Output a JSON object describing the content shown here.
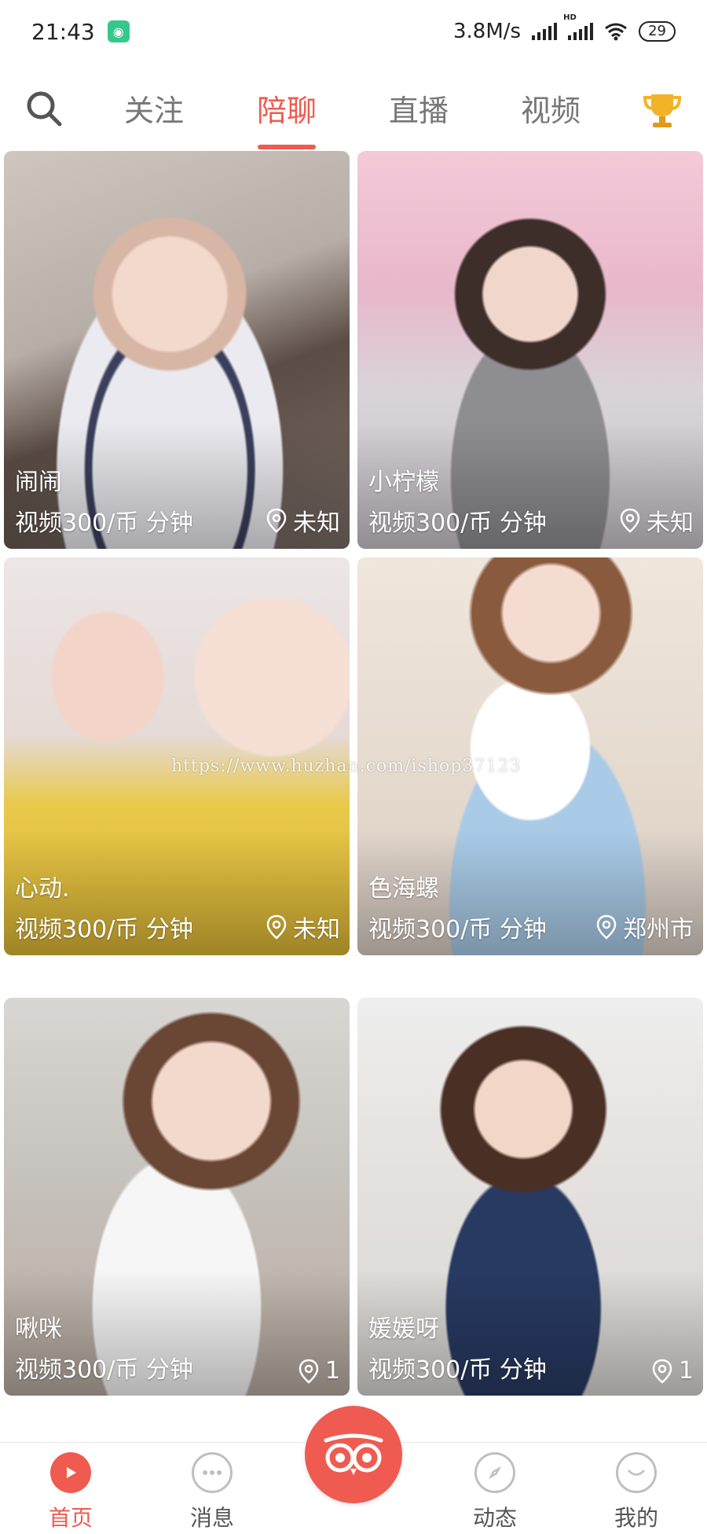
{
  "status_bar": {
    "time": "21:43",
    "network_speed": "3.8M/s",
    "battery": "29",
    "hd_label": "HD",
    "app_icon": "app-notification-icon"
  },
  "top_nav": {
    "search_icon": "search-icon",
    "tabs": [
      {
        "label": "关注",
        "active": false
      },
      {
        "label": "陪聊",
        "active": true
      },
      {
        "label": "直播",
        "active": false
      },
      {
        "label": "视频",
        "active": false
      }
    ],
    "trophy_icon": "trophy-icon",
    "accent_color": "#ef5b50"
  },
  "cards": [
    {
      "name": "闹闹",
      "price": "视频300/币 分钟",
      "location": "未知"
    },
    {
      "name": "小柠檬",
      "price": "视频300/币 分钟",
      "location": "未知"
    },
    {
      "name": "心动.",
      "price": "视频300/币 分钟",
      "location": "未知"
    },
    {
      "name": "色海螺",
      "price": "视频300/币 分钟",
      "location": "郑州市"
    },
    {
      "name": "啾咪",
      "price": "视频300/币 分钟",
      "location": "1"
    },
    {
      "name": "媛媛呀",
      "price": "视频300/币 分钟",
      "location": "1"
    }
  ],
  "watermark": "https://www.huzhan.com/ishop37123",
  "bottom_nav": [
    {
      "label": "首页",
      "icon": "home-play-icon",
      "active": true
    },
    {
      "label": "消息",
      "icon": "chat-bubble-icon",
      "active": false
    },
    {
      "label": "",
      "icon": "owl-icon",
      "active": false
    },
    {
      "label": "动态",
      "icon": "compass-icon",
      "active": false
    },
    {
      "label": "我的",
      "icon": "profile-smile-icon",
      "active": false
    }
  ]
}
